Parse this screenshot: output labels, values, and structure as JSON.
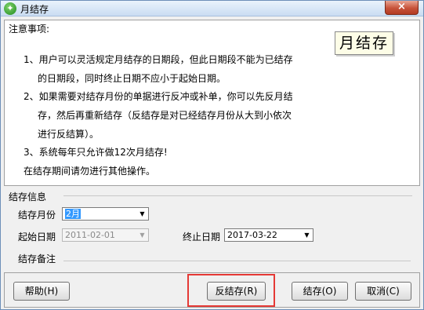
{
  "window": {
    "title": "月结存",
    "close_label": "×"
  },
  "notice": {
    "heading": "注意事项:",
    "stamp": "月结存",
    "lines": [
      "1、用户可以灵活规定月结存的日期段，但此日期段不能为已结存",
      "的日期段，同时终止日期不应小于起始日期。",
      "2、如果需要对结存月份的单据进行反冲或补单，你可以先反月结",
      "存，然后再重新结存（反结存是对已经结存月份从大到小依次",
      "进行反结算）。",
      "3、系统每年只允许做12次月结存!",
      "在结存期间请勿进行其他操作。"
    ]
  },
  "info": {
    "section_title": "结存信息",
    "month_label": "结存月份",
    "month_value": "2月",
    "start_label": "起始日期",
    "start_value": "2011-02-01",
    "end_label": "终止日期",
    "end_value": "2017-03-22",
    "remark_label": "结存备注"
  },
  "buttons": {
    "help": "帮助(H)",
    "reverse": "反结存(R)",
    "close_out": "结存(O)",
    "cancel": "取消(C)"
  },
  "colors": {
    "highlight": "#e53935",
    "selection": "#3399ff"
  }
}
